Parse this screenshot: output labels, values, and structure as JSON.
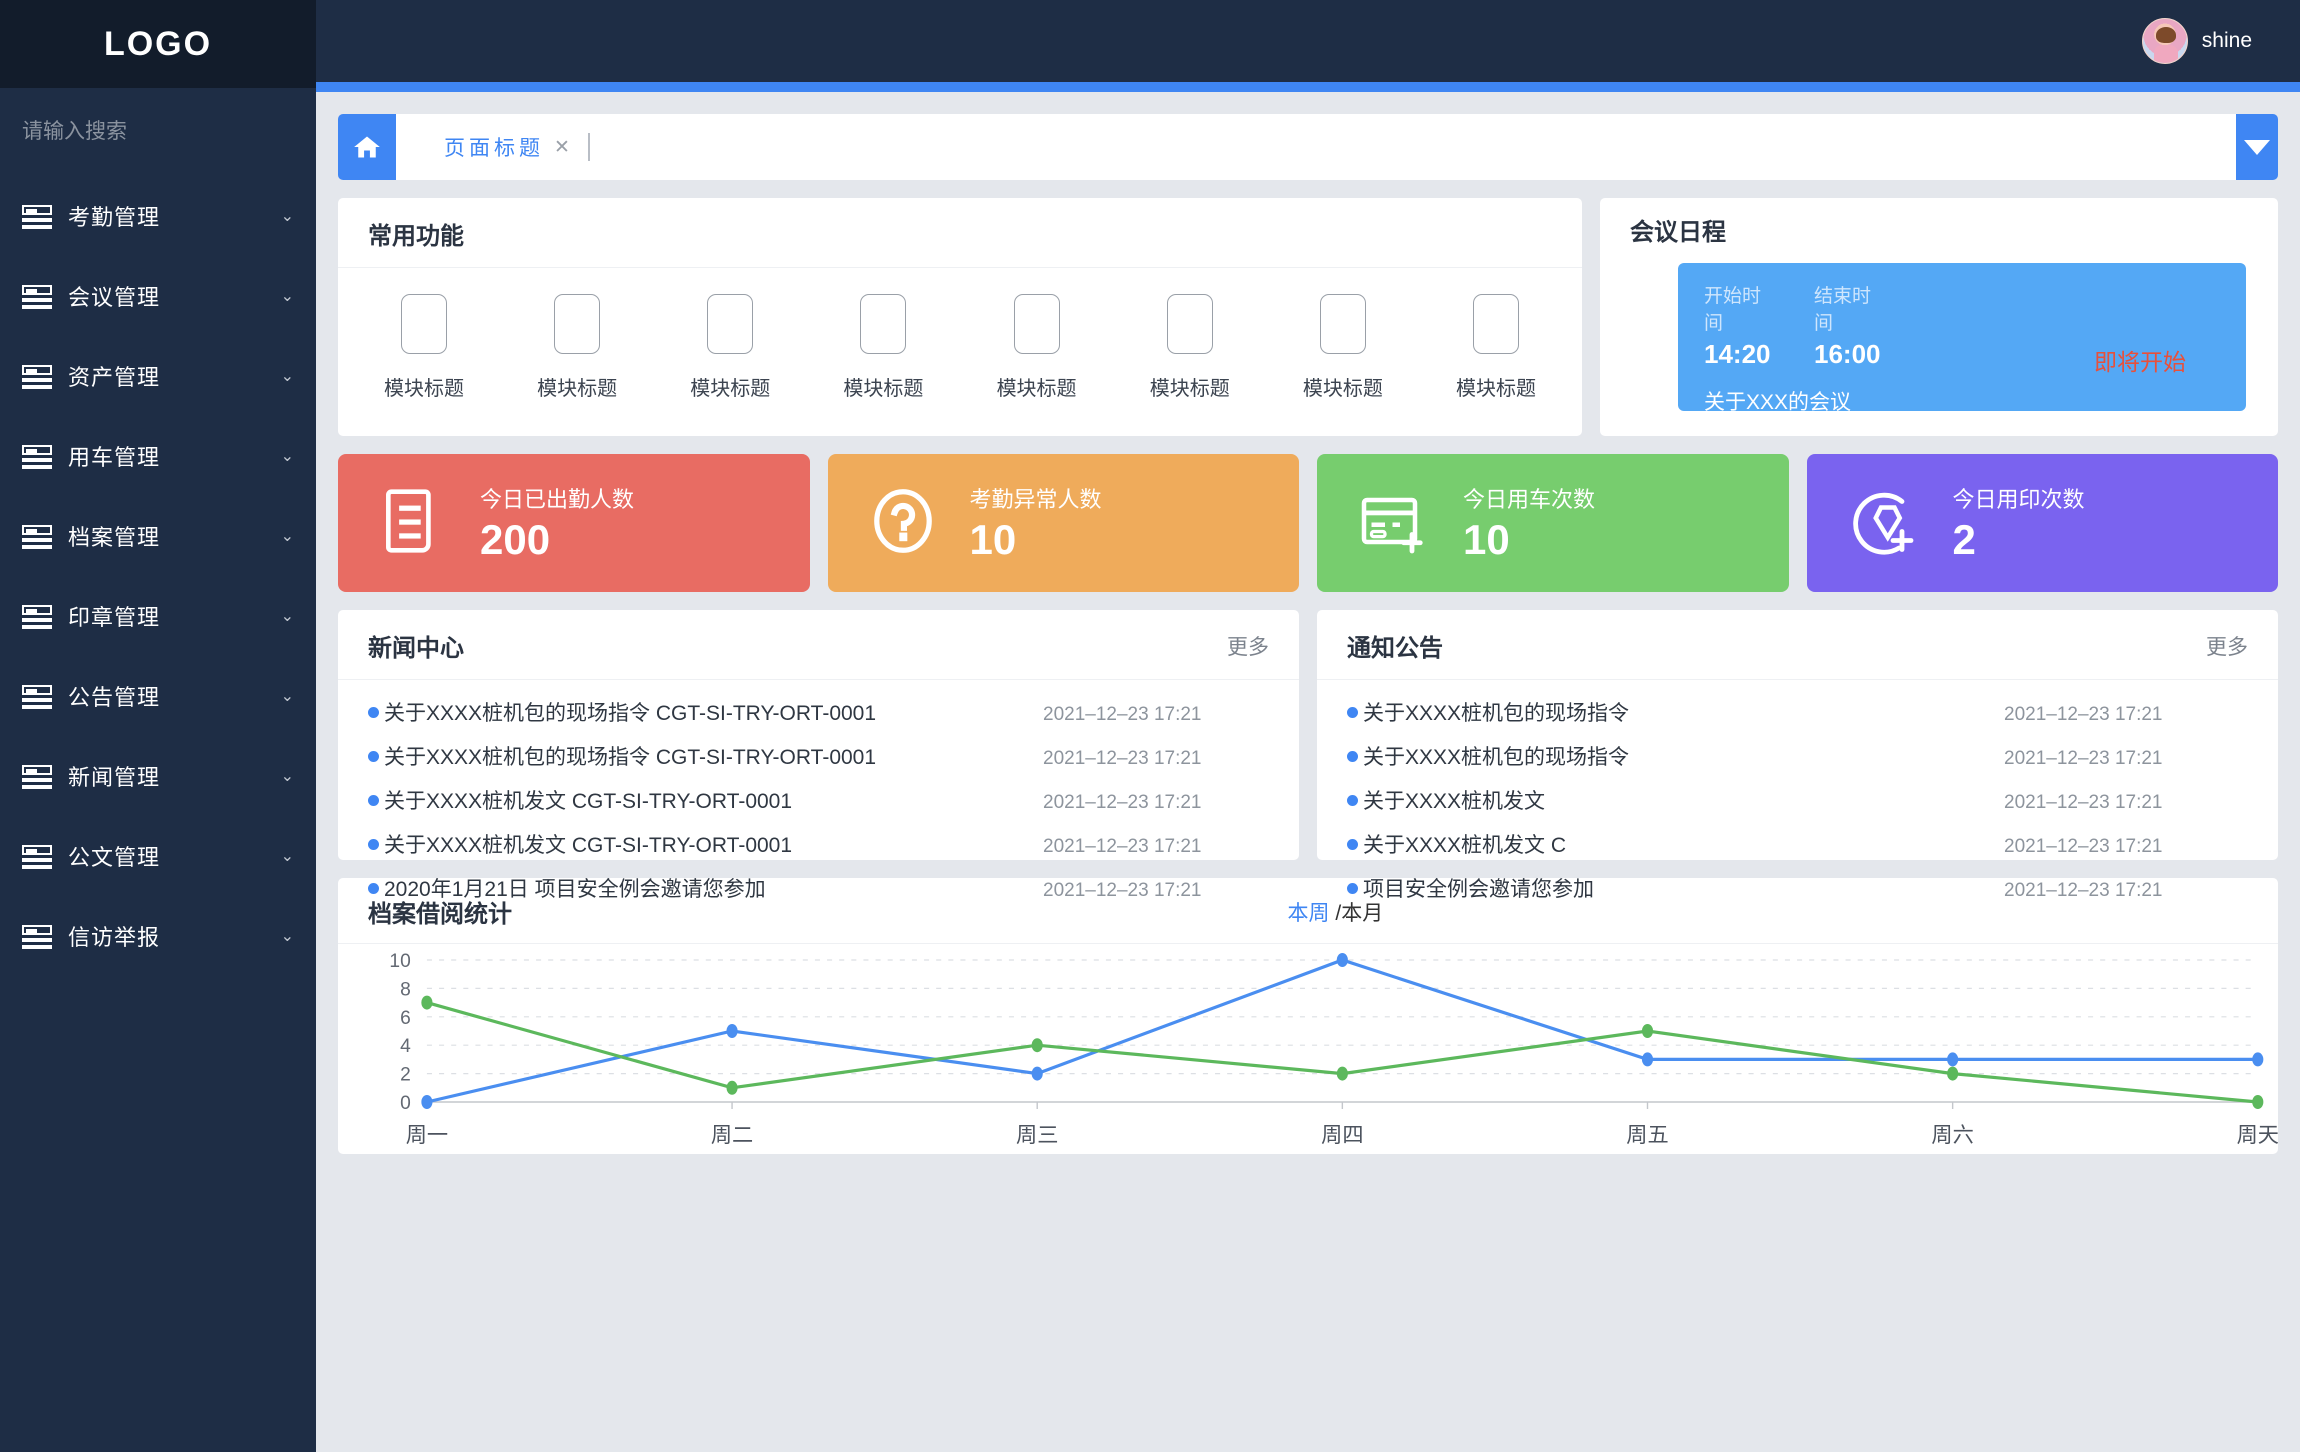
{
  "sidebar": {
    "logo": "LOGO",
    "search_placeholder": "请输入搜索",
    "items": [
      {
        "label": "考勤管理",
        "chevron": "⌄"
      },
      {
        "label": "会议管理",
        "chevron": "⌄"
      },
      {
        "label": "资产管理",
        "chevron": "⌄"
      },
      {
        "label": "用车管理",
        "chevron": "⌄"
      },
      {
        "label": "档案管理",
        "chevron": "⌄"
      },
      {
        "label": "印章管理",
        "chevron": "⌄"
      },
      {
        "label": "公告管理",
        "chevron": "⌄"
      },
      {
        "label": "新闻管理",
        "chevron": "⌄"
      },
      {
        "label": "公文管理",
        "chevron": "⌄"
      },
      {
        "label": "信访举报",
        "chevron": "⌄"
      }
    ]
  },
  "topbar": {
    "user_name": "shine"
  },
  "tabbar": {
    "tab_label": "页面标题",
    "tab_close": "✕"
  },
  "common_functions": {
    "title": "常用功能",
    "items": [
      {
        "label": "模块标题"
      },
      {
        "label": "模块标题"
      },
      {
        "label": "模块标题"
      },
      {
        "label": "模块标题"
      },
      {
        "label": "模块标题"
      },
      {
        "label": "模块标题"
      },
      {
        "label": "模块标题"
      },
      {
        "label": "模块标题"
      }
    ]
  },
  "meeting": {
    "title": "会议日程",
    "start_label": "开始时间",
    "end_label": "结束时间",
    "start_time": "14:20",
    "end_time": "16:00",
    "subject": "关于XXX的会议",
    "status": "即将开始",
    "card_color": "#54a8f5",
    "status_color": "#e8503a"
  },
  "stats": [
    {
      "label": "今日已出勤人数",
      "value": "200",
      "color": "#e86c63",
      "icon": "document-icon"
    },
    {
      "label": "考勤异常人数",
      "value": "10",
      "color": "#efab5b",
      "icon": "question-circle-icon"
    },
    {
      "label": "今日用车次数",
      "value": "10",
      "color": "#77cd6e",
      "icon": "card-plus-icon"
    },
    {
      "label": "今日用印次数",
      "value": "2",
      "color": "#7a63ef",
      "icon": "stamp-plus-icon"
    }
  ],
  "news": {
    "title": "新闻中心",
    "more": "更多",
    "items": [
      {
        "text": "关于XXXX桩机包的现场指令  CGT-SI-TRY-ORT-0001",
        "date": "2021–12–23  17:21"
      },
      {
        "text": "关于XXXX桩机包的现场指令  CGT-SI-TRY-ORT-0001",
        "date": "2021–12–23  17:21"
      },
      {
        "text": "关于XXXX桩机发文 CGT-SI-TRY-ORT-0001",
        "date": "2021–12–23  17:21"
      },
      {
        "text": "关于XXXX桩机发文 CGT-SI-TRY-ORT-0001",
        "date": "2021–12–23  17:21"
      },
      {
        "text": "2020年1月21日  项目安全例会邀请您参加",
        "date": "2021–12–23  17:21"
      }
    ]
  },
  "notice": {
    "title": "通知公告",
    "more": "更多",
    "items": [
      {
        "text": "关于XXXX桩机包的现场指令",
        "date": "2021–12–23  17:21"
      },
      {
        "text": "关于XXXX桩机包的现场指令",
        "date": "2021–12–23  17:21"
      },
      {
        "text": "关于XXXX桩机发文",
        "date": "2021–12–23  17:21"
      },
      {
        "text": "关于XXXX桩机发文 C",
        "date": "2021–12–23  17:21"
      },
      {
        "text": "项目安全例会邀请您参加",
        "date": "2021–12–23  17:21"
      }
    ]
  },
  "archive_chart": {
    "title": "档案借阅统计",
    "range_week": "本周",
    "range_sep": " /",
    "range_month": "本月"
  },
  "chart_data": {
    "type": "line",
    "title": "档案借阅统计",
    "xlabel": "",
    "ylabel": "",
    "categories": [
      "周一",
      "周二",
      "周三",
      "周四",
      "周五",
      "周六",
      "周天"
    ],
    "yticks": [
      0,
      2,
      4,
      6,
      8,
      10
    ],
    "ylim": [
      0,
      10
    ],
    "grid": true,
    "legend": "none",
    "series": [
      {
        "name": "series-blue",
        "color": "#4a8ef0",
        "values": [
          0,
          5,
          2,
          10,
          3,
          3,
          3
        ]
      },
      {
        "name": "series-green",
        "color": "#5cb85c",
        "values": [
          7,
          1,
          4,
          2,
          5,
          2,
          0
        ]
      }
    ]
  }
}
